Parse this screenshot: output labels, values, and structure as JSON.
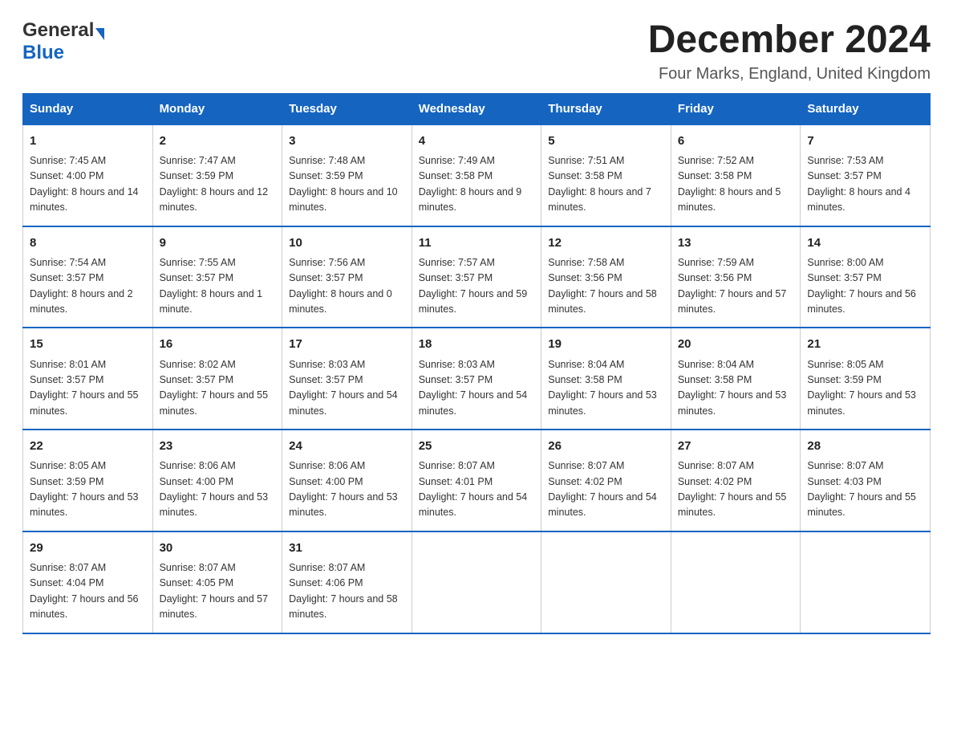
{
  "logo": {
    "general": "General",
    "blue": "Blue"
  },
  "header": {
    "month_year": "December 2024",
    "location": "Four Marks, England, United Kingdom"
  },
  "days_of_week": [
    "Sunday",
    "Monday",
    "Tuesday",
    "Wednesday",
    "Thursday",
    "Friday",
    "Saturday"
  ],
  "weeks": [
    [
      {
        "day": 1,
        "sunrise": "7:45 AM",
        "sunset": "4:00 PM",
        "daylight": "8 hours and 14 minutes."
      },
      {
        "day": 2,
        "sunrise": "7:47 AM",
        "sunset": "3:59 PM",
        "daylight": "8 hours and 12 minutes."
      },
      {
        "day": 3,
        "sunrise": "7:48 AM",
        "sunset": "3:59 PM",
        "daylight": "8 hours and 10 minutes."
      },
      {
        "day": 4,
        "sunrise": "7:49 AM",
        "sunset": "3:58 PM",
        "daylight": "8 hours and 9 minutes."
      },
      {
        "day": 5,
        "sunrise": "7:51 AM",
        "sunset": "3:58 PM",
        "daylight": "8 hours and 7 minutes."
      },
      {
        "day": 6,
        "sunrise": "7:52 AM",
        "sunset": "3:58 PM",
        "daylight": "8 hours and 5 minutes."
      },
      {
        "day": 7,
        "sunrise": "7:53 AM",
        "sunset": "3:57 PM",
        "daylight": "8 hours and 4 minutes."
      }
    ],
    [
      {
        "day": 8,
        "sunrise": "7:54 AM",
        "sunset": "3:57 PM",
        "daylight": "8 hours and 2 minutes."
      },
      {
        "day": 9,
        "sunrise": "7:55 AM",
        "sunset": "3:57 PM",
        "daylight": "8 hours and 1 minute."
      },
      {
        "day": 10,
        "sunrise": "7:56 AM",
        "sunset": "3:57 PM",
        "daylight": "8 hours and 0 minutes."
      },
      {
        "day": 11,
        "sunrise": "7:57 AM",
        "sunset": "3:57 PM",
        "daylight": "7 hours and 59 minutes."
      },
      {
        "day": 12,
        "sunrise": "7:58 AM",
        "sunset": "3:56 PM",
        "daylight": "7 hours and 58 minutes."
      },
      {
        "day": 13,
        "sunrise": "7:59 AM",
        "sunset": "3:56 PM",
        "daylight": "7 hours and 57 minutes."
      },
      {
        "day": 14,
        "sunrise": "8:00 AM",
        "sunset": "3:57 PM",
        "daylight": "7 hours and 56 minutes."
      }
    ],
    [
      {
        "day": 15,
        "sunrise": "8:01 AM",
        "sunset": "3:57 PM",
        "daylight": "7 hours and 55 minutes."
      },
      {
        "day": 16,
        "sunrise": "8:02 AM",
        "sunset": "3:57 PM",
        "daylight": "7 hours and 55 minutes."
      },
      {
        "day": 17,
        "sunrise": "8:03 AM",
        "sunset": "3:57 PM",
        "daylight": "7 hours and 54 minutes."
      },
      {
        "day": 18,
        "sunrise": "8:03 AM",
        "sunset": "3:57 PM",
        "daylight": "7 hours and 54 minutes."
      },
      {
        "day": 19,
        "sunrise": "8:04 AM",
        "sunset": "3:58 PM",
        "daylight": "7 hours and 53 minutes."
      },
      {
        "day": 20,
        "sunrise": "8:04 AM",
        "sunset": "3:58 PM",
        "daylight": "7 hours and 53 minutes."
      },
      {
        "day": 21,
        "sunrise": "8:05 AM",
        "sunset": "3:59 PM",
        "daylight": "7 hours and 53 minutes."
      }
    ],
    [
      {
        "day": 22,
        "sunrise": "8:05 AM",
        "sunset": "3:59 PM",
        "daylight": "7 hours and 53 minutes."
      },
      {
        "day": 23,
        "sunrise": "8:06 AM",
        "sunset": "4:00 PM",
        "daylight": "7 hours and 53 minutes."
      },
      {
        "day": 24,
        "sunrise": "8:06 AM",
        "sunset": "4:00 PM",
        "daylight": "7 hours and 53 minutes."
      },
      {
        "day": 25,
        "sunrise": "8:07 AM",
        "sunset": "4:01 PM",
        "daylight": "7 hours and 54 minutes."
      },
      {
        "day": 26,
        "sunrise": "8:07 AM",
        "sunset": "4:02 PM",
        "daylight": "7 hours and 54 minutes."
      },
      {
        "day": 27,
        "sunrise": "8:07 AM",
        "sunset": "4:02 PM",
        "daylight": "7 hours and 55 minutes."
      },
      {
        "day": 28,
        "sunrise": "8:07 AM",
        "sunset": "4:03 PM",
        "daylight": "7 hours and 55 minutes."
      }
    ],
    [
      {
        "day": 29,
        "sunrise": "8:07 AM",
        "sunset": "4:04 PM",
        "daylight": "7 hours and 56 minutes."
      },
      {
        "day": 30,
        "sunrise": "8:07 AM",
        "sunset": "4:05 PM",
        "daylight": "7 hours and 57 minutes."
      },
      {
        "day": 31,
        "sunrise": "8:07 AM",
        "sunset": "4:06 PM",
        "daylight": "7 hours and 58 minutes."
      },
      null,
      null,
      null,
      null
    ]
  ],
  "labels": {
    "sunrise": "Sunrise:",
    "sunset": "Sunset:",
    "daylight": "Daylight:"
  }
}
